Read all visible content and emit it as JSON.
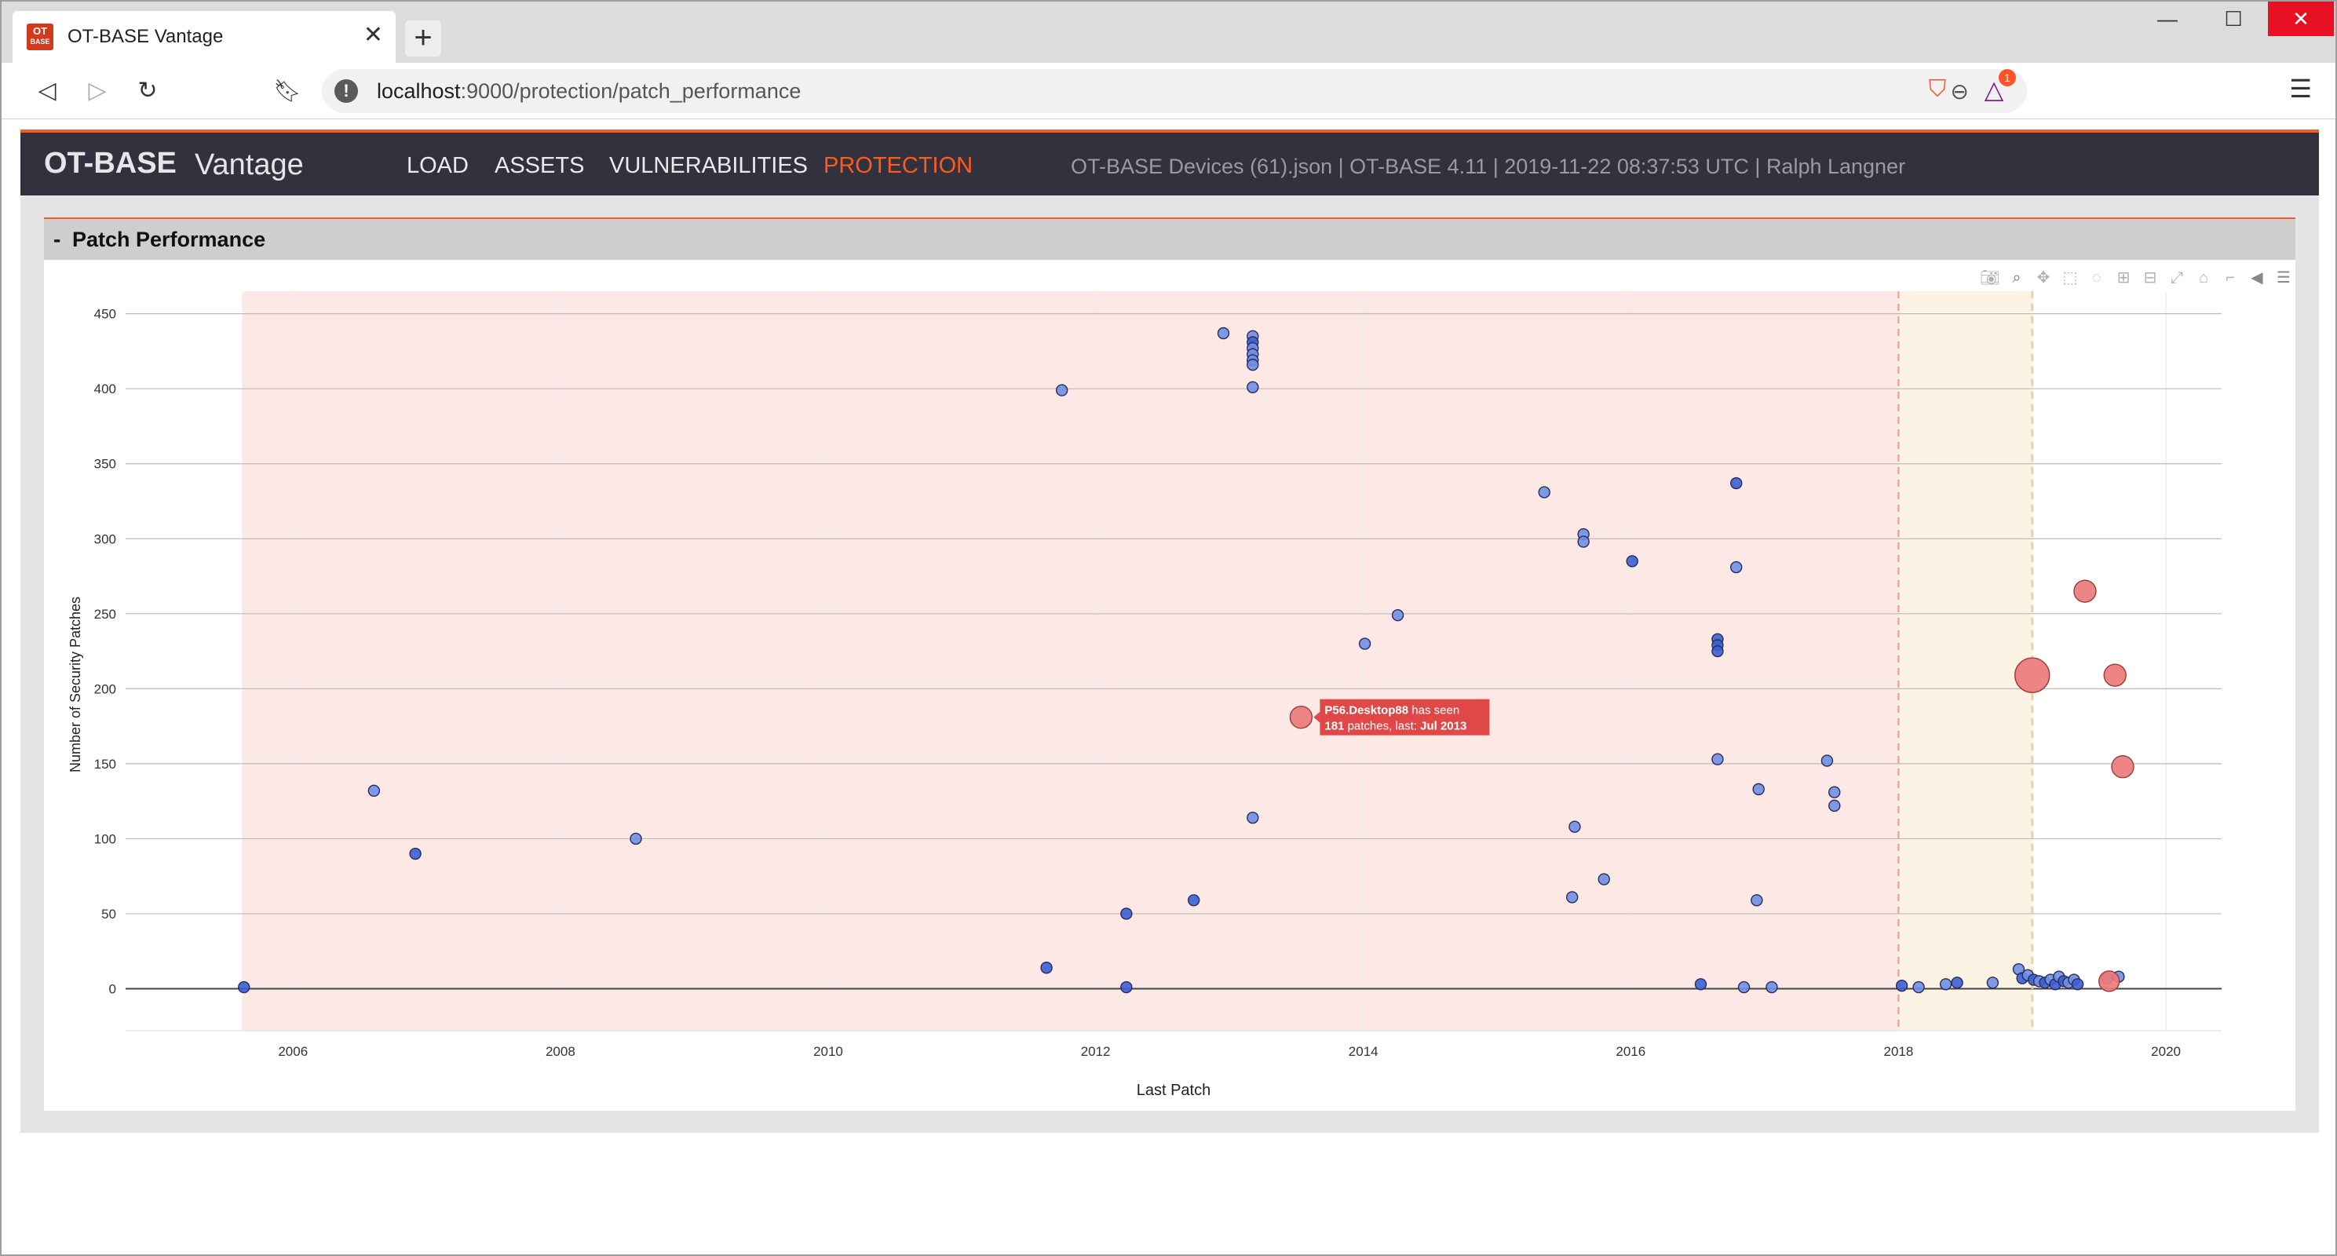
{
  "browser": {
    "tab_title": "OT-BASE Vantage",
    "favicon_text_top": "OT",
    "favicon_text_bottom": "BASE",
    "url_host": "localhost",
    "url_path": ":9000/protection/patch_performance",
    "extension_badge": "1",
    "icons": {
      "back": "back-arrow-icon",
      "forward": "forward-arrow-icon",
      "reload": "reload-icon",
      "bookmark": "bookmark-icon",
      "info": "info-icon",
      "zoom": "zoom-out-icon",
      "brave": "brave-shield-icon",
      "rewards": "brave-rewards-icon",
      "menu": "hamburger-menu-icon"
    }
  },
  "app": {
    "brand_strong": "OT-BASE",
    "brand_light": "Vantage",
    "nav": [
      "LOAD",
      "ASSETS",
      "VULNERABILITIES",
      "PROTECTION"
    ],
    "active_nav": "PROTECTION",
    "info": "OT-BASE Devices (61).json | OT-BASE 4.11 | 2019-11-22 08:37:53 UTC | Ralph Langner",
    "accent_color": "#ff5a1f",
    "nav_bg": "#32323e"
  },
  "panel": {
    "toggle": "-",
    "title": "Patch Performance"
  },
  "chart_data": {
    "type": "scatter",
    "xlabel": "Last Patch",
    "ylabel": "Number of Security Patches",
    "x_range": [
      "2004-10-01",
      "2020-06-01"
    ],
    "x_ticks": [
      "2006",
      "2008",
      "2010",
      "2012",
      "2014",
      "2016",
      "2018",
      "2020"
    ],
    "x_tick_dates": [
      "2006-01-01",
      "2008-01-01",
      "2010-01-01",
      "2012-01-01",
      "2014-01-01",
      "2016-01-01",
      "2018-01-01",
      "2020-01-01"
    ],
    "y_range": [
      -28,
      465
    ],
    "y_ticks": [
      0,
      50,
      100,
      150,
      200,
      250,
      300,
      350,
      400,
      450
    ],
    "grid": true,
    "shaded_regions": [
      {
        "x0": "2005-08-15",
        "x1": "2018-01-01",
        "color": "#fce8e4"
      },
      {
        "x0": "2018-01-01",
        "x1": "2019-01-01",
        "color": "#fdf3e4"
      }
    ],
    "vlines": [
      {
        "x": "2018-01-01",
        "color": "#f0a89a"
      },
      {
        "x": "2019-01-01",
        "color": "#f5c890"
      }
    ],
    "points_blue": [
      {
        "x": "2005-08-20",
        "y": 1,
        "dark": true
      },
      {
        "x": "2006-08-10",
        "y": 132
      },
      {
        "x": "2006-12-01",
        "y": 90,
        "dark": true
      },
      {
        "x": "2008-07-25",
        "y": 100
      },
      {
        "x": "2011-08-20",
        "y": 14,
        "dark": true
      },
      {
        "x": "2011-10-01",
        "y": 399
      },
      {
        "x": "2012-03-25",
        "y": 50,
        "dark": true
      },
      {
        "x": "2012-03-25",
        "y": 1,
        "dark": true
      },
      {
        "x": "2012-09-25",
        "y": 59,
        "dark": true
      },
      {
        "x": "2012-12-15",
        "y": 437
      },
      {
        "x": "2013-03-05",
        "y": 435
      },
      {
        "x": "2013-03-05",
        "y": 431,
        "dark": true
      },
      {
        "x": "2013-03-05",
        "y": 427
      },
      {
        "x": "2013-03-05",
        "y": 423
      },
      {
        "x": "2013-03-05",
        "y": 419
      },
      {
        "x": "2013-03-05",
        "y": 416
      },
      {
        "x": "2013-03-05",
        "y": 401
      },
      {
        "x": "2013-03-05",
        "y": 114
      },
      {
        "x": "2014-01-05",
        "y": 230
      },
      {
        "x": "2014-04-05",
        "y": 249
      },
      {
        "x": "2015-05-10",
        "y": 331
      },
      {
        "x": "2015-07-25",
        "y": 61
      },
      {
        "x": "2015-08-01",
        "y": 108
      },
      {
        "x": "2015-08-25",
        "y": 303
      },
      {
        "x": "2015-08-25",
        "y": 298
      },
      {
        "x": "2015-10-20",
        "y": 73
      },
      {
        "x": "2016-01-05",
        "y": 285,
        "dark": true
      },
      {
        "x": "2016-07-10",
        "y": 3,
        "dark": true
      },
      {
        "x": "2016-08-25",
        "y": 233,
        "dark": true
      },
      {
        "x": "2016-08-25",
        "y": 229,
        "dark": true
      },
      {
        "x": "2016-08-25",
        "y": 225,
        "dark": true
      },
      {
        "x": "2016-08-25",
        "y": 153
      },
      {
        "x": "2016-10-15",
        "y": 337,
        "dark": true
      },
      {
        "x": "2016-10-15",
        "y": 281
      },
      {
        "x": "2016-11-05",
        "y": 1
      },
      {
        "x": "2016-12-10",
        "y": 59
      },
      {
        "x": "2016-12-15",
        "y": 133
      },
      {
        "x": "2017-01-20",
        "y": 1
      },
      {
        "x": "2017-06-20",
        "y": 152
      },
      {
        "x": "2017-07-10",
        "y": 131
      },
      {
        "x": "2017-07-10",
        "y": 122
      },
      {
        "x": "2018-01-10",
        "y": 2,
        "dark": true
      },
      {
        "x": "2018-02-25",
        "y": 1
      },
      {
        "x": "2018-05-10",
        "y": 3
      },
      {
        "x": "2018-06-10",
        "y": 4,
        "dark": true
      },
      {
        "x": "2018-09-15",
        "y": 4
      },
      {
        "x": "2018-11-25",
        "y": 13
      },
      {
        "x": "2018-12-05",
        "y": 7,
        "dark": true
      },
      {
        "x": "2018-12-20",
        "y": 9
      },
      {
        "x": "2019-01-05",
        "y": 6,
        "dark": true
      },
      {
        "x": "2019-01-20",
        "y": 5
      },
      {
        "x": "2019-02-05",
        "y": 4,
        "dark": true
      },
      {
        "x": "2019-02-20",
        "y": 6
      },
      {
        "x": "2019-03-05",
        "y": 3,
        "dark": true
      },
      {
        "x": "2019-03-15",
        "y": 8
      },
      {
        "x": "2019-03-28",
        "y": 5,
        "dark": true
      },
      {
        "x": "2019-04-10",
        "y": 4
      },
      {
        "x": "2019-04-25",
        "y": 6
      },
      {
        "x": "2019-05-05",
        "y": 3,
        "dark": true
      },
      {
        "x": "2019-07-25",
        "y": 7
      },
      {
        "x": "2019-08-25",
        "y": 8
      }
    ],
    "points_red": [
      {
        "x": "2013-07-15",
        "y": 181,
        "size": 14
      },
      {
        "x": "2019-01-01",
        "y": 209,
        "size": 22
      },
      {
        "x": "2019-05-25",
        "y": 265,
        "size": 14
      },
      {
        "x": "2019-08-15",
        "y": 209,
        "size": 14
      },
      {
        "x": "2019-09-05",
        "y": 148,
        "size": 14
      },
      {
        "x": "2019-07-30",
        "y": 5,
        "size": 13
      }
    ],
    "blue_color": "#6f8fe6",
    "blue_dark_color": "#3a5fd6",
    "red_color": "#ec7b7b",
    "tooltip": {
      "name": "P56.Desktop88",
      "text1": " has seen",
      "count": "181",
      "text2": " patches, last: ",
      "date": "Jul 2013",
      "anchor_x": "2013-07-15",
      "anchor_y": 181,
      "color": "#e04848"
    }
  },
  "modebar_icons": [
    "camera-icon",
    "zoom-icon",
    "pan-icon",
    "box-select-icon",
    "lasso-icon",
    "zoom-in-icon",
    "zoom-out-icon",
    "autoscale-icon",
    "reset-axes-icon",
    "spike-lines-icon",
    "hover-closest-icon",
    "hover-compare-icon"
  ]
}
